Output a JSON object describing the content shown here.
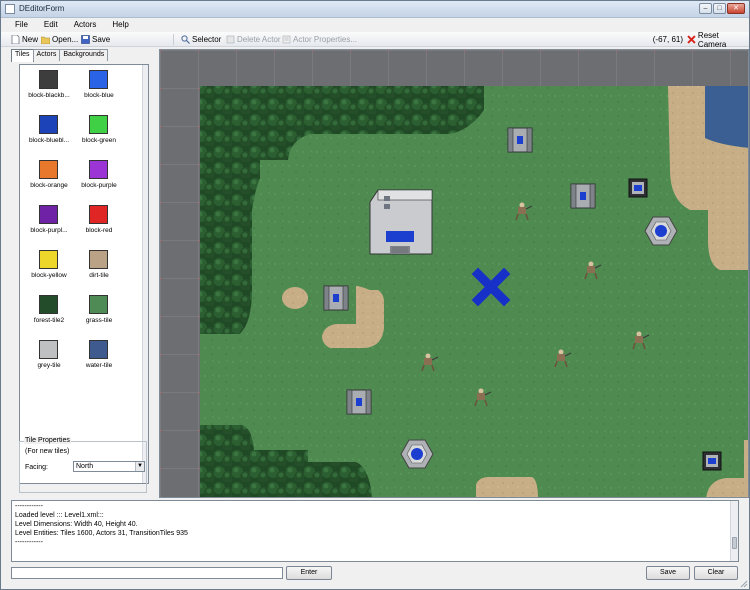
{
  "window": {
    "title": "DEditorForm"
  },
  "menu": {
    "file": "File",
    "edit": "Edit",
    "actors": "Actors",
    "help": "Help"
  },
  "toolbar": {
    "new": "New",
    "open": "Open...",
    "save": "Save",
    "selector": "Selector",
    "delete_actor": "Delete Actor",
    "actor_properties": "Actor Properties...",
    "coords": "(-67, 61)",
    "reset_camera": "Reset Camera"
  },
  "left_panel": {
    "tabs": [
      "Tiles",
      "Actors",
      "Backgrounds"
    ],
    "tiles": [
      {
        "label": "block-blackb...",
        "color": "#3d3d3d"
      },
      {
        "label": "block-blue",
        "color": "#2a63e6"
      },
      {
        "label": "block-bluebl...",
        "color": "#1c43b8"
      },
      {
        "label": "block-green",
        "color": "#3fd046"
      },
      {
        "label": "block-orange",
        "color": "#e8782b"
      },
      {
        "label": "block-purple",
        "color": "#9c35d6"
      },
      {
        "label": "block-purpl...",
        "color": "#6f22a5"
      },
      {
        "label": "block-red",
        "color": "#e02525"
      },
      {
        "label": "block-yellow",
        "color": "#ecd72a"
      },
      {
        "label": "dirt-tile",
        "color": "#b9a285"
      },
      {
        "label": "forest-tile2",
        "color": "#234d2a"
      },
      {
        "label": "grass-tile",
        "color": "#4f8b54"
      },
      {
        "label": "grey-tile",
        "color": "#bfc0c2"
      },
      {
        "label": "water-tile",
        "color": "#3f5a8e"
      }
    ],
    "properties": {
      "title": "Tile Properties",
      "subtitle": "(For new tiles)",
      "facing_label": "Facing:",
      "facing_value": "North"
    }
  },
  "console": {
    "lines": [
      "------------",
      "Loaded level ::: Level1.xml:::",
      "Level Dimensions: Width 40, Height 40.",
      "Level Entities: Tiles 1600, Actors 31, TransitionTiles 935",
      "------------"
    ]
  },
  "bottom": {
    "enter": "Enter",
    "save": "Save",
    "clear": "Clear"
  },
  "colors": {
    "grass": "#4e8a50",
    "forest": "#1e4a26",
    "dirt": "#c7ad86",
    "road": "#6b6d70",
    "water": "#3a5f92",
    "marker": "#1630c8"
  }
}
